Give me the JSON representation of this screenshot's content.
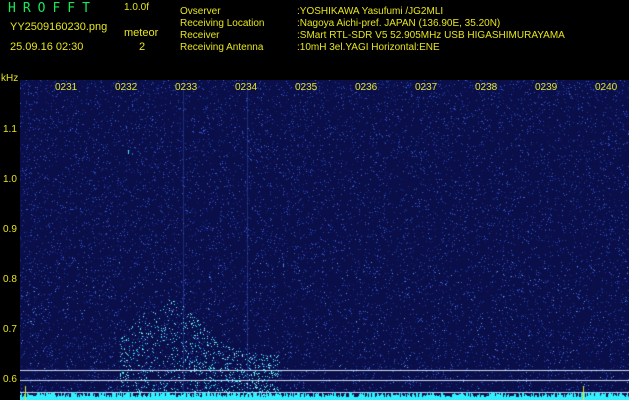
{
  "header": {
    "logo": "HROFFT",
    "version": "1.0.0f",
    "file_name": "YY2509160230.png",
    "meteor_label": "meteor",
    "meteor_count": "2",
    "datetime": "25.09.16 02:30"
  },
  "info": [
    {
      "key": "Ovserver",
      "value": ":YOSHIKAWA Yasufumi /JG2MLI"
    },
    {
      "key": "Receiving Location",
      "value": ":Nagoya Aichi-pref. JAPAN (136.90E, 35.20N)"
    },
    {
      "key": "Receiver",
      "value": ":SMart RTL-SDR V5 52.905MHz USB HIGASHIMURAYAMA"
    },
    {
      "key": "Receiving Antenna",
      "value": ":10mH 3el.YAGI Horizontal:ENE"
    }
  ],
  "spectrogram": {
    "freq_unit": "kHz",
    "time_labels": [
      "0231",
      "0232",
      "0233",
      "0234",
      "0235",
      "0236",
      "0237",
      "0238",
      "0239",
      "0240"
    ],
    "freq_labels": [
      "1.1",
      "1.0",
      "0.9",
      "0.8",
      "0.7",
      "0.6"
    ],
    "colors": {
      "background": "#0a0f4a",
      "speckle": "#2a48c8",
      "trace": "#33f0ff",
      "marker": "#e7e51d",
      "hline": "#c8d8f0"
    }
  }
}
